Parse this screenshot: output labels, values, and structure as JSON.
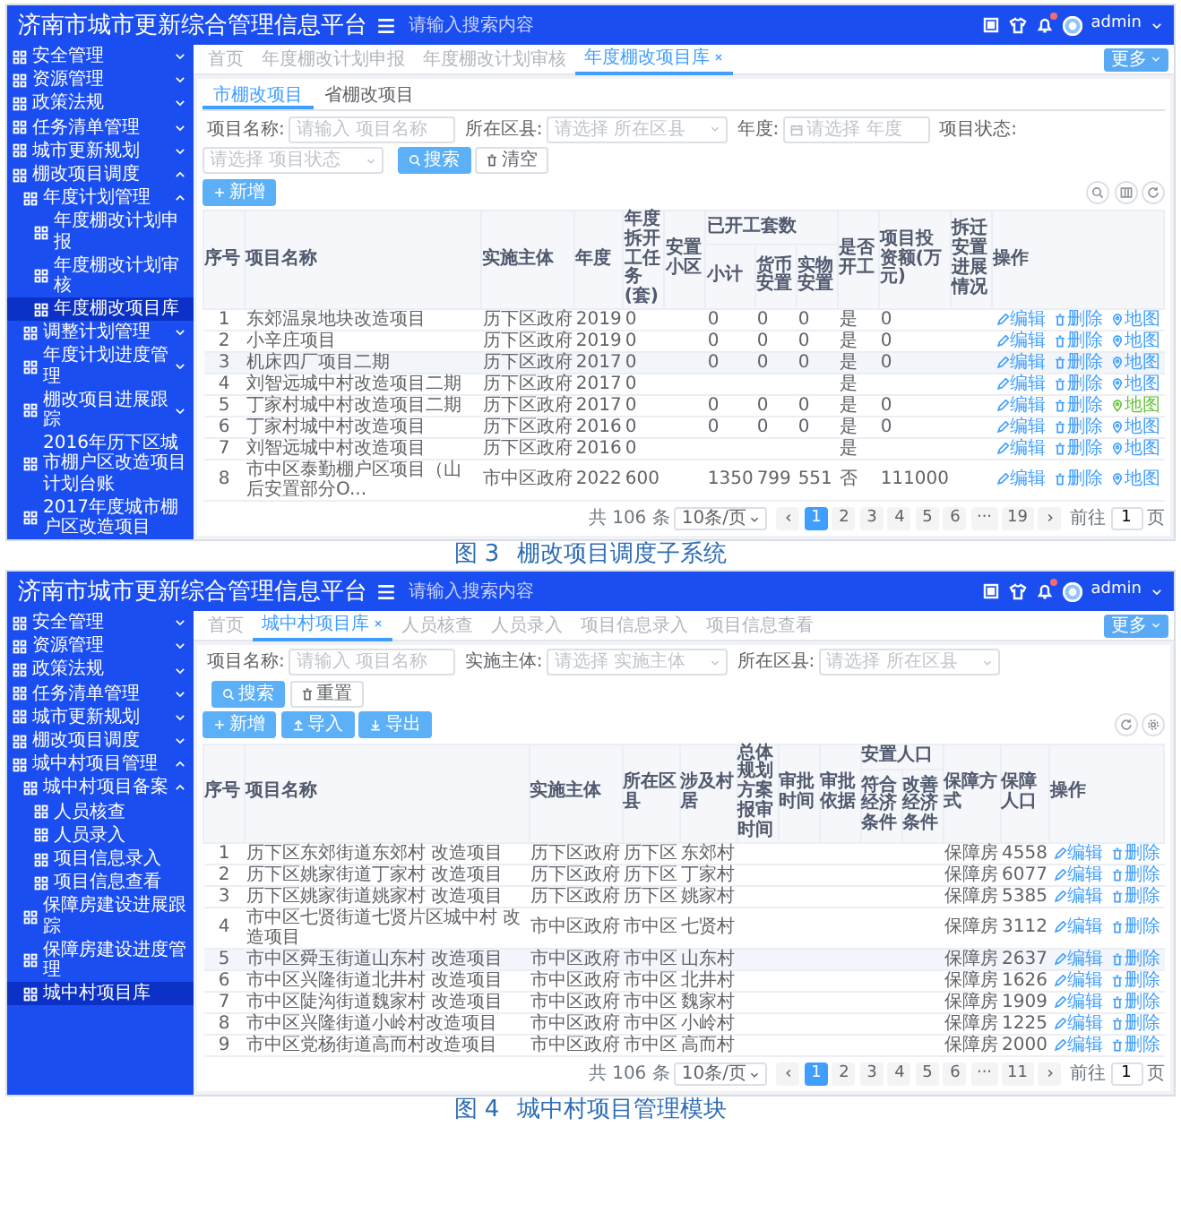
{
  "figures": [
    {
      "header": {
        "title": "济南市城市更新综合管理信息平台",
        "search_placeholder": "请输入搜索内容",
        "user": "admin",
        "notification_dot": true
      },
      "sidebar": [
        {
          "label": "安全管理",
          "expanded": false,
          "selected": false
        },
        {
          "label": "资源管理",
          "expanded": false,
          "selected": false
        },
        {
          "label": "政策法规",
          "expanded": false,
          "selected": false
        },
        {
          "label": "任务清单管理",
          "expanded": false,
          "selected": false
        },
        {
          "label": "城市更新规划",
          "expanded": false,
          "selected": false
        },
        {
          "label": "棚改项目调度",
          "expanded": true,
          "selected": false,
          "children": [
            {
              "label": "年度计划管理",
              "expanded": true,
              "selected": false,
              "children": [
                {
                  "label": "年度棚改计划申报",
                  "selected": false
                },
                {
                  "label": "年度棚改计划审核",
                  "selected": false
                },
                {
                  "label": "年度棚改项目库",
                  "selected": true
                }
              ]
            },
            {
              "label": "调整计划管理",
              "expanded": false,
              "selected": false
            },
            {
              "label": "年度计划进度管理",
              "expanded": false,
              "selected": false
            },
            {
              "label": "棚改项目进展跟踪",
              "expanded": false,
              "selected": false
            },
            {
              "label": "2016年历下区城市棚户区改造项目计划台账",
              "selected": false
            },
            {
              "label": "2017年度城市棚户区改造项目",
              "selected": false
            }
          ]
        }
      ],
      "tabs": [
        {
          "label": "首页",
          "selected": false
        },
        {
          "label": "年度棚改计划申报",
          "selected": false
        },
        {
          "label": "年度棚改计划审核",
          "selected": false
        },
        {
          "label": "年度棚改项目库",
          "selected": true
        }
      ],
      "more_button": "更多",
      "subtabs": [
        {
          "label": "市棚改项目",
          "selected": true
        },
        {
          "label": "省棚改项目",
          "selected": false
        }
      ],
      "filters": [
        {
          "label": "项目名称:",
          "placeholder": "请输入 项目名称",
          "kind": "text"
        },
        {
          "label": "所在区县:",
          "placeholder": "请选择 所在区县",
          "kind": "select"
        },
        {
          "label": "年度:",
          "placeholder": "请选择 年度",
          "kind": "date"
        },
        {
          "label": "项目状态:",
          "placeholder": "请选择 项目状态",
          "kind": "select"
        }
      ],
      "filter_buttons": [
        {
          "label": "搜索",
          "kind": "search"
        },
        {
          "label": "清空",
          "kind": "clear"
        }
      ],
      "action_buttons": [
        {
          "label": "新增",
          "kind": "add"
        }
      ],
      "tool_icons": [
        {
          "kind": "search"
        },
        {
          "kind": "columns"
        },
        {
          "kind": "refresh"
        }
      ],
      "table": {
        "header_rows": [
          [
            {
              "label": "序号",
              "rowspan": 2
            },
            {
              "label": "项目名称",
              "rowspan": 2
            },
            {
              "label": "实施主体",
              "rowspan": 2
            },
            {
              "label": "年度",
              "rowspan": 2
            },
            {
              "label": "年度拆开工任务(套)",
              "rowspan": 2
            },
            {
              "label": "安置小区",
              "rowspan": 2
            },
            {
              "label": "已开工套数",
              "colspan": 3
            },
            {
              "label": "是否开工",
              "rowspan": 2
            },
            {
              "label": "项目投资额(万元)",
              "rowspan": 2
            },
            {
              "label": "拆迁安置进展情况",
              "rowspan": 2
            },
            {
              "label": "操作",
              "rowspan": 2
            }
          ],
          [
            {
              "label": "小计"
            },
            {
              "label": "货币安置"
            },
            {
              "label": "实物安置"
            }
          ]
        ],
        "rows": [
          {
            "highlighted": false,
            "cells": [
              "1",
              "东郊温泉地块改造项目",
              "历下区政府",
              "2019",
              "0",
              "",
              "0",
              "0",
              "0",
              "是",
              "0",
              ""
            ],
            "actions": [
              {
                "kind": "edit",
                "label": "编辑"
              },
              {
                "kind": "delete",
                "label": "删除"
              },
              {
                "kind": "map",
                "label": "地图",
                "active": false
              }
            ]
          },
          {
            "highlighted": false,
            "cells": [
              "2",
              "小辛庄项目",
              "历下区政府",
              "2019",
              "0",
              "",
              "0",
              "0",
              "0",
              "是",
              "0",
              ""
            ],
            "actions": [
              {
                "kind": "edit",
                "label": "编辑"
              },
              {
                "kind": "delete",
                "label": "删除"
              },
              {
                "kind": "map",
                "label": "地图",
                "active": false
              }
            ]
          },
          {
            "highlighted": true,
            "cells": [
              "3",
              "机床四厂项目二期",
              "历下区政府",
              "2017",
              "0",
              "",
              "0",
              "0",
              "0",
              "是",
              "0",
              ""
            ],
            "actions": [
              {
                "kind": "edit",
                "label": "编辑"
              },
              {
                "kind": "delete",
                "label": "删除"
              },
              {
                "kind": "map",
                "label": "地图",
                "active": false
              }
            ]
          },
          {
            "highlighted": false,
            "cells": [
              "4",
              "刘智远城中村改造项目二期",
              "历下区政府",
              "2017",
              "0",
              "",
              "",
              "",
              "",
              "是",
              "",
              ""
            ],
            "actions": [
              {
                "kind": "edit",
                "label": "编辑"
              },
              {
                "kind": "delete",
                "label": "删除"
              },
              {
                "kind": "map",
                "label": "地图",
                "active": false
              }
            ]
          },
          {
            "highlighted": false,
            "cells": [
              "5",
              "丁家村城中村改造项目二期",
              "历下区政府",
              "2017",
              "0",
              "",
              "0",
              "0",
              "0",
              "是",
              "0",
              ""
            ],
            "actions": [
              {
                "kind": "edit",
                "label": "编辑"
              },
              {
                "kind": "delete",
                "label": "删除"
              },
              {
                "kind": "map",
                "label": "地图",
                "active": true
              }
            ]
          },
          {
            "highlighted": false,
            "cells": [
              "6",
              "丁家村城中村改造项目",
              "历下区政府",
              "2016",
              "0",
              "",
              "0",
              "0",
              "0",
              "是",
              "0",
              ""
            ],
            "actions": [
              {
                "kind": "edit",
                "label": "编辑"
              },
              {
                "kind": "delete",
                "label": "删除"
              },
              {
                "kind": "map",
                "label": "地图",
                "active": false
              }
            ]
          },
          {
            "highlighted": false,
            "cells": [
              "7",
              "刘智远城中村改造项目",
              "历下区政府",
              "2016",
              "0",
              "",
              "",
              "",
              "",
              "是",
              "",
              ""
            ],
            "actions": [
              {
                "kind": "edit",
                "label": "编辑"
              },
              {
                "kind": "delete",
                "label": "删除"
              },
              {
                "kind": "map",
                "label": "地图",
                "active": false
              }
            ]
          },
          {
            "highlighted": false,
            "cells": [
              "8",
              "市中区泰勤棚户区项目（山后安置部分O...",
              "市中区政府",
              "2022",
              "600",
              "",
              "1350",
              "799",
              "551",
              "否",
              "111000",
              ""
            ],
            "actions": [
              {
                "kind": "edit",
                "label": "编辑"
              },
              {
                "kind": "delete",
                "label": "删除"
              },
              {
                "kind": "map",
                "label": "地图",
                "active": false
              }
            ]
          }
        ]
      },
      "pagination": {
        "total": "共 106 条",
        "page_size": "10条/页",
        "pages": [
          {
            "label": "1",
            "selected": true
          },
          {
            "label": "2",
            "selected": false
          },
          {
            "label": "3",
            "selected": false
          },
          {
            "label": "4",
            "selected": false
          },
          {
            "label": "5",
            "selected": false
          },
          {
            "label": "6",
            "selected": false
          },
          {
            "label": "···",
            "selected": false
          },
          {
            "label": "19",
            "selected": false
          }
        ],
        "goto_label": "前往",
        "goto_value": "1",
        "goto_suffix": "页"
      },
      "caption": {
        "number": "图 3",
        "title": "棚改项目调度子系统"
      }
    },
    {
      "header": {
        "title": "济南市城市更新综合管理信息平台",
        "search_placeholder": "请输入搜索内容",
        "user": "admin",
        "notification_dot": true
      },
      "sidebar": [
        {
          "label": "安全管理",
          "expanded": false,
          "selected": false
        },
        {
          "label": "资源管理",
          "expanded": false,
          "selected": false
        },
        {
          "label": "政策法规",
          "expanded": false,
          "selected": false
        },
        {
          "label": "任务清单管理",
          "expanded": false,
          "selected": false
        },
        {
          "label": "城市更新规划",
          "expanded": false,
          "selected": false
        },
        {
          "label": "棚改项目调度",
          "expanded": false,
          "selected": false
        },
        {
          "label": "城中村项目管理",
          "expanded": true,
          "selected": false,
          "children": [
            {
              "label": "城中村项目备案",
              "expanded": true,
              "selected": false,
              "children": [
                {
                  "label": "人员核查",
                  "selected": false
                },
                {
                  "label": "人员录入",
                  "selected": false
                },
                {
                  "label": "项目信息录入",
                  "selected": false
                },
                {
                  "label": "项目信息查看",
                  "selected": false
                }
              ]
            },
            {
              "label": "保障房建设进展跟踪",
              "selected": false
            },
            {
              "label": "保障房建设进度管理",
              "selected": false
            },
            {
              "label": "城中村项目库",
              "selected": true
            }
          ]
        }
      ],
      "tabs": [
        {
          "label": "首页",
          "selected": false
        },
        {
          "label": "城中村项目库",
          "selected": true
        },
        {
          "label": "人员核查",
          "selected": false
        },
        {
          "label": "人员录入",
          "selected": false
        },
        {
          "label": "项目信息录入",
          "selected": false
        },
        {
          "label": "项目信息查看",
          "selected": false
        }
      ],
      "more_button": "更多",
      "filters": [
        {
          "label": "项目名称:",
          "placeholder": "请输入 项目名称",
          "kind": "text"
        },
        {
          "label": "实施主体:",
          "placeholder": "请选择 实施主体",
          "kind": "select"
        },
        {
          "label": "所在区县:",
          "placeholder": "请选择 所在区县",
          "kind": "select"
        }
      ],
      "filter_buttons": [
        {
          "label": "搜索",
          "kind": "search"
        },
        {
          "label": "重置",
          "kind": "clear"
        }
      ],
      "action_buttons": [
        {
          "label": "新增",
          "kind": "add"
        },
        {
          "label": "导入",
          "kind": "import"
        },
        {
          "label": "导出",
          "kind": "export"
        }
      ],
      "tool_icons": [
        {
          "kind": "refresh"
        },
        {
          "kind": "settings"
        }
      ],
      "table": {
        "header_rows": [
          [
            {
              "label": "序号",
              "rowspan": 2
            },
            {
              "label": "项目名称",
              "rowspan": 2
            },
            {
              "label": "实施主体",
              "rowspan": 2
            },
            {
              "label": "所在区县",
              "rowspan": 2
            },
            {
              "label": "涉及村居",
              "rowspan": 2
            },
            {
              "label": "总体规划方案报审时间",
              "rowspan": 2
            },
            {
              "label": "审批时间",
              "rowspan": 2
            },
            {
              "label": "审批依据",
              "rowspan": 2
            },
            {
              "label": "安置人口",
              "colspan": 2
            },
            {
              "label": "保障方式",
              "rowspan": 2
            },
            {
              "label": "保障人口",
              "rowspan": 2
            },
            {
              "label": "操作",
              "rowspan": 2
            }
          ],
          [
            {
              "label": "符合经济条件"
            },
            {
              "label": "改善经济条件"
            }
          ]
        ],
        "rows": [
          {
            "highlighted": false,
            "cells": [
              "1",
              "历下区东郊街道东郊村 改造项目",
              "历下区政府",
              "历下区",
              "东郊村",
              "",
              "",
              "",
              "",
              "",
              "保障房",
              "4558"
            ],
            "actions": [
              {
                "kind": "edit",
                "label": "编辑"
              },
              {
                "kind": "delete",
                "label": "删除"
              }
            ]
          },
          {
            "highlighted": false,
            "cells": [
              "2",
              "历下区姚家街道丁家村 改造项目",
              "历下区政府",
              "历下区",
              "丁家村",
              "",
              "",
              "",
              "",
              "",
              "保障房",
              "6077"
            ],
            "actions": [
              {
                "kind": "edit",
                "label": "编辑"
              },
              {
                "kind": "delete",
                "label": "删除"
              }
            ]
          },
          {
            "highlighted": false,
            "cells": [
              "3",
              "历下区姚家街道姚家村 改造项目",
              "历下区政府",
              "历下区",
              "姚家村",
              "",
              "",
              "",
              "",
              "",
              "保障房",
              "5385"
            ],
            "actions": [
              {
                "kind": "edit",
                "label": "编辑"
              },
              {
                "kind": "delete",
                "label": "删除"
              }
            ]
          },
          {
            "highlighted": false,
            "cells": [
              "4",
              "市中区七贤街道七贤片区城中村 改造项目",
              "市中区政府",
              "市中区",
              "七贤村",
              "",
              "",
              "",
              "",
              "",
              "保障房",
              "3112"
            ],
            "actions": [
              {
                "kind": "edit",
                "label": "编辑"
              },
              {
                "kind": "delete",
                "label": "删除"
              }
            ]
          },
          {
            "highlighted": true,
            "cells": [
              "5",
              "市中区舜玉街道山东村 改造项目",
              "市中区政府",
              "市中区",
              "山东村",
              "",
              "",
              "",
              "",
              "",
              "保障房",
              "2637"
            ],
            "actions": [
              {
                "kind": "edit",
                "label": "编辑"
              },
              {
                "kind": "delete",
                "label": "删除"
              }
            ]
          },
          {
            "highlighted": false,
            "cells": [
              "6",
              "市中区兴隆街道北井村 改造项目",
              "市中区政府",
              "市中区",
              "北井村",
              "",
              "",
              "",
              "",
              "",
              "保障房",
              "1626"
            ],
            "actions": [
              {
                "kind": "edit",
                "label": "编辑"
              },
              {
                "kind": "delete",
                "label": "删除"
              }
            ]
          },
          {
            "highlighted": false,
            "cells": [
              "7",
              "市中区陡沟街道魏家村 改造项目",
              "市中区政府",
              "市中区",
              "魏家村",
              "",
              "",
              "",
              "",
              "",
              "保障房",
              "1909"
            ],
            "actions": [
              {
                "kind": "edit",
                "label": "编辑"
              },
              {
                "kind": "delete",
                "label": "删除"
              }
            ]
          },
          {
            "highlighted": false,
            "cells": [
              "8",
              "市中区兴隆街道小岭村改造项目",
              "市中区政府",
              "市中区",
              "小岭村",
              "",
              "",
              "",
              "",
              "",
              "保障房",
              "1225"
            ],
            "actions": [
              {
                "kind": "edit",
                "label": "编辑"
              },
              {
                "kind": "delete",
                "label": "删除"
              }
            ]
          },
          {
            "highlighted": false,
            "cells": [
              "9",
              "市中区党杨街道高而村改造项目",
              "市中区政府",
              "市中区",
              "高而村",
              "",
              "",
              "",
              "",
              "",
              "保障房",
              "2000"
            ],
            "actions": [
              {
                "kind": "edit",
                "label": "编辑"
              },
              {
                "kind": "delete",
                "label": "删除"
              }
            ]
          }
        ]
      },
      "pagination": {
        "total": "共 106 条",
        "page_size": "10条/页",
        "pages": [
          {
            "label": "1",
            "selected": true
          },
          {
            "label": "2",
            "selected": false
          },
          {
            "label": "3",
            "selected": false
          },
          {
            "label": "4",
            "selected": false
          },
          {
            "label": "5",
            "selected": false
          },
          {
            "label": "6",
            "selected": false
          },
          {
            "label": "···",
            "selected": false
          },
          {
            "label": "11",
            "selected": false
          }
        ],
        "goto_label": "前往",
        "goto_value": "1",
        "goto_suffix": "页"
      },
      "caption": {
        "number": "图 4",
        "title": "城中村项目管理模块"
      }
    }
  ]
}
